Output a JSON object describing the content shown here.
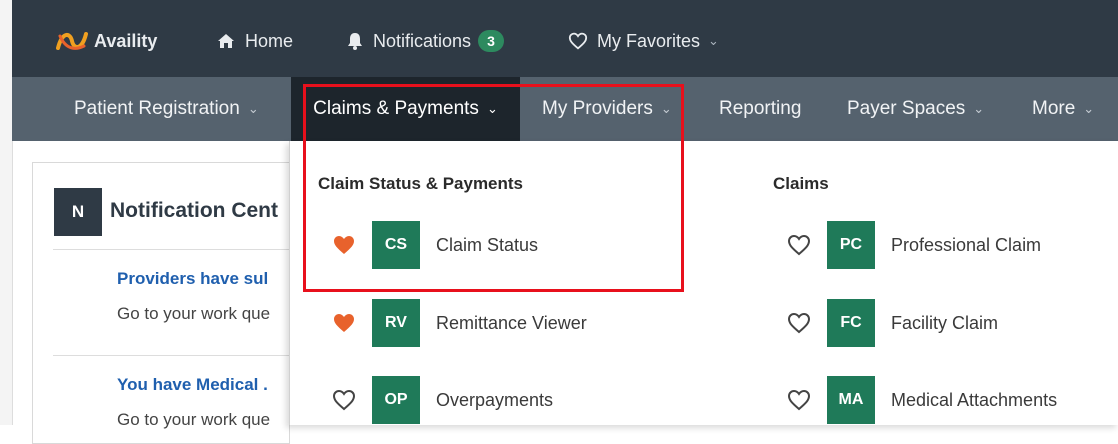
{
  "topbar": {
    "brand": "Availity",
    "home": "Home",
    "notifications": "Notifications",
    "notifications_count": "3",
    "favorites": "My Favorites"
  },
  "nav": {
    "patient_registration": "Patient Registration",
    "claims_payments": "Claims & Payments",
    "my_providers": "My Providers",
    "reporting": "Reporting",
    "payer_spaces": "Payer Spaces",
    "more": "More"
  },
  "notification_center": {
    "icon_letter": "N",
    "title": "Notification Cent",
    "messages": [
      {
        "title": "Providers have sul",
        "body": "Go to your work que"
      },
      {
        "title": "You have Medical .",
        "body": "Go to your work que"
      }
    ]
  },
  "dropdown": {
    "col1_heading": "Claim Status & Payments",
    "col2_heading": "Claims",
    "col1_items": [
      {
        "abbr": "CS",
        "label": "Claim Status",
        "favorite": true
      },
      {
        "abbr": "RV",
        "label": "Remittance Viewer",
        "favorite": true
      },
      {
        "abbr": "OP",
        "label": "Overpayments",
        "favorite": false
      }
    ],
    "col2_items": [
      {
        "abbr": "PC",
        "label": "Professional Claim",
        "favorite": false
      },
      {
        "abbr": "FC",
        "label": "Facility Claim",
        "favorite": false
      },
      {
        "abbr": "MA",
        "label": "Medical Attachments",
        "favorite": false
      }
    ]
  },
  "colors": {
    "topbar_bg": "#2f3a45",
    "navbar_bg": "#55626e",
    "active_nav_bg": "#1d252c",
    "tile_green": "#1f7a59",
    "favorite_orange": "#e8622c",
    "highlight_red": "#e8101c"
  }
}
